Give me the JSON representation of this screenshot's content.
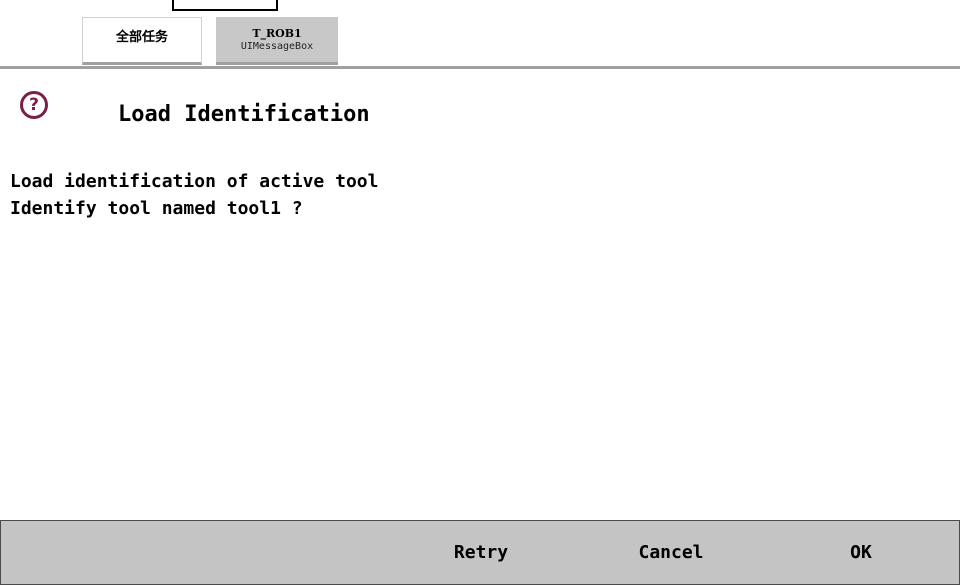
{
  "tabs": {
    "all_tasks": "全部任务",
    "active_task": {
      "title": "T_ROB1",
      "subtitle": "UIMessageBox"
    }
  },
  "dialog": {
    "icon": "question-icon",
    "title": "Load Identification",
    "message_lines": [
      "Load identification of active tool",
      "Identify tool named tool1 ?"
    ],
    "accent_color": "#7a1f4a"
  },
  "buttons": {
    "retry": "Retry",
    "cancel": "Cancel",
    "ok": "OK"
  },
  "colors": {
    "button_bar": "#c4c4c4",
    "active_tab": "#c8c8c8",
    "rule": "#a0a0a0"
  }
}
